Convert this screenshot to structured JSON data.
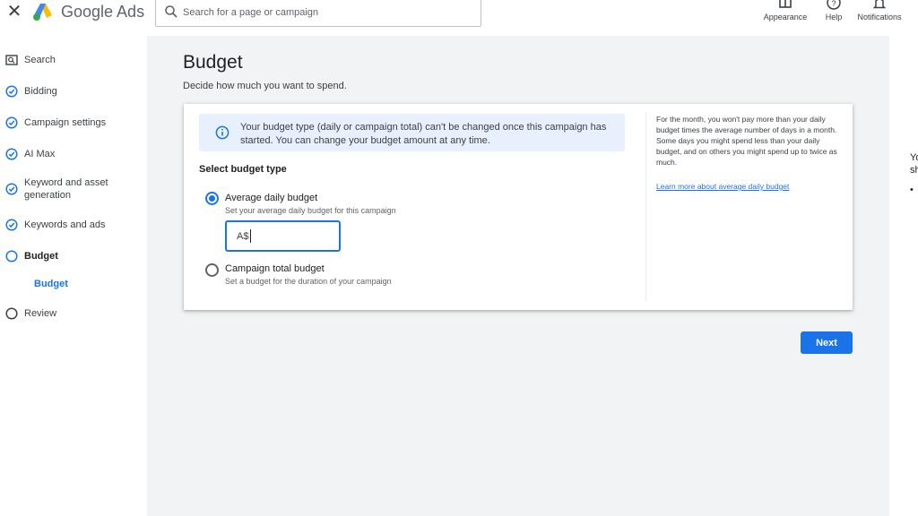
{
  "header": {
    "brand": "Google Ads",
    "search_placeholder": "Search for a page or campaign",
    "buttons": [
      {
        "label": "Appearance",
        "icon": "appearance-icon"
      },
      {
        "label": "Help",
        "icon": "help-icon"
      },
      {
        "label": "Notifications",
        "icon": "bell-icon"
      }
    ]
  },
  "sidebar": {
    "items": [
      {
        "label": "Search",
        "icon": "search-campaign-icon"
      },
      {
        "label": "Bidding",
        "icon": "check-circle-icon"
      },
      {
        "label": "Campaign settings",
        "icon": "check-circle-icon"
      },
      {
        "label": "AI Max",
        "icon": "check-circle-icon"
      },
      {
        "label": "Keyword and asset generation",
        "icon": "check-circle-icon"
      },
      {
        "label": "Keywords and ads",
        "icon": "check-circle-icon"
      },
      {
        "label": "Budget",
        "icon": "current-step-circle-icon"
      },
      {
        "label": "Review",
        "icon": "empty-circle-icon"
      }
    ],
    "sub_item": "Budget"
  },
  "main": {
    "title": "Budget",
    "subtitle": "Decide how much you want to spend.",
    "info": "Your budget type (daily or campaign total) can't be changed once this campaign has started. You can change your budget amount at any time.",
    "section_label": "Select budget type",
    "options": [
      {
        "title": "Average daily budget",
        "desc": "Set your average daily budget for this campaign",
        "selected": true
      },
      {
        "title": "Campaign total budget",
        "desc": "Set a budget for the duration of your campaign",
        "selected": false
      }
    ],
    "amount_prefix": "A$",
    "help_text": "For the month, you won't pay more than your daily budget times the average number of days in a month. Some days you might spend less than your daily budget, and on others you might spend up to twice as much.",
    "help_link": "Learn more about average daily budget",
    "next_label": "Next"
  },
  "right_panel": {
    "line1": "Yo",
    "line2": "sh",
    "bullet": "•"
  },
  "colors": {
    "accent": "#1a73e8",
    "background": "#f1f3f4",
    "info_bg": "#e8f0fe"
  }
}
